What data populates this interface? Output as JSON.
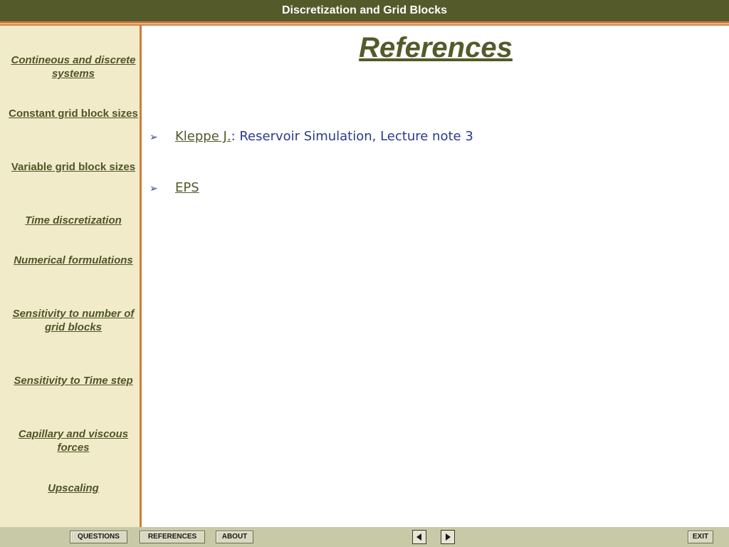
{
  "header": {
    "title": "Discretization and Grid Blocks"
  },
  "sidebar": {
    "items": [
      {
        "label": "Contineous and discrete systems"
      },
      {
        "label": " Constant grid block sizes"
      },
      {
        "label": "Variable grid  block sizes"
      },
      {
        "label": "Time discretization"
      },
      {
        "label": "Numerical formulations"
      },
      {
        "label": "Sensitivity to number of grid blocks"
      },
      {
        "label": "Sensitivity to Time step"
      },
      {
        "label": "Capillary and viscous forces"
      },
      {
        "label": "Upscaling"
      }
    ]
  },
  "main": {
    "title": "References",
    "references": [
      {
        "bullet": "➢",
        "link": "Kleppe J.",
        "separator": ": ",
        "description": "Reservoir Simulation, Lecture note 3"
      },
      {
        "bullet": "➢",
        "link": "EPS",
        "separator": "",
        "description": ""
      }
    ]
  },
  "footer": {
    "questions_label": "QUESTIONS",
    "references_label": "REFERENCES",
    "about_label": "ABOUT",
    "exit_label": "EXIT"
  },
  "colors": {
    "titlebar": "#545a2a",
    "accent": "#d27a3c",
    "sidebar_bg": "#f1ebc9",
    "link": "#545a2a",
    "text_blue": "#2b3a8f"
  }
}
